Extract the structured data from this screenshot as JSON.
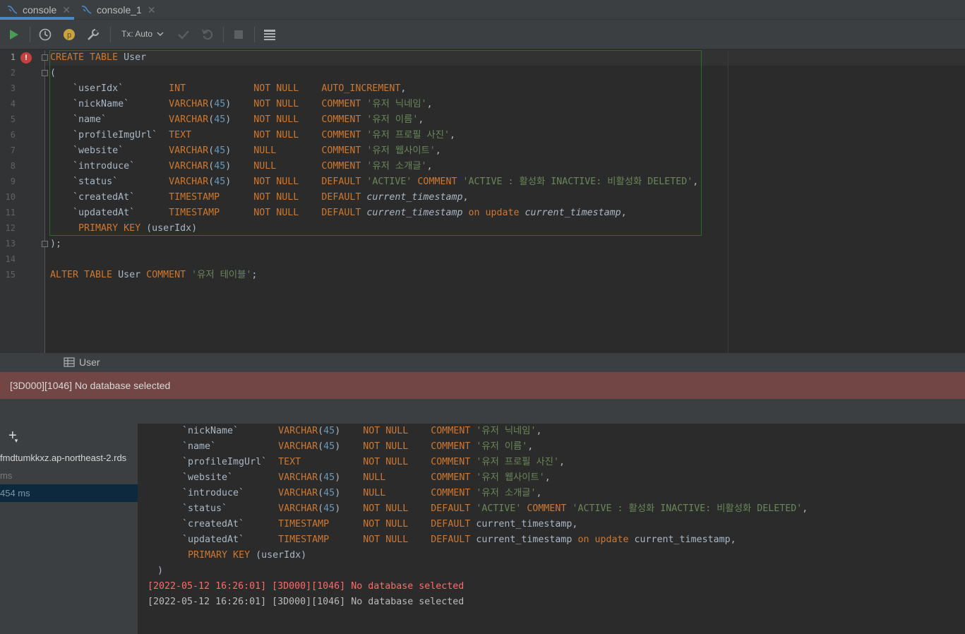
{
  "tabs": [
    {
      "label": "console",
      "icon": "mysql-console-icon",
      "active": true
    },
    {
      "label": "console_1",
      "icon": "mysql-console-icon",
      "active": false
    }
  ],
  "toolbar": {
    "tx_label": "Tx: Auto",
    "buttons": [
      "execute-icon",
      "history-icon",
      "parameters-icon",
      "settings-wrench-icon",
      "commit-icon",
      "rollback-icon",
      "stop-icon",
      "results-table-icon"
    ]
  },
  "editor": {
    "line_numbers": [
      "1",
      "2",
      "3",
      "4",
      "5",
      "6",
      "7",
      "8",
      "9",
      "10",
      "11",
      "12",
      "13",
      "14",
      "15"
    ],
    "lines": [
      [
        [
          "kw",
          "CREATE TABLE "
        ],
        [
          "pl",
          "User"
        ]
      ],
      [
        [
          "pl",
          "("
        ]
      ],
      [
        [
          "pl",
          "    "
        ],
        [
          "bq",
          "`userIdx`"
        ],
        [
          "pl",
          "        "
        ],
        [
          "kw",
          "INT"
        ],
        [
          "pl",
          "            "
        ],
        [
          "kw",
          "NOT NULL"
        ],
        [
          "pl",
          "    "
        ],
        [
          "kw",
          "AUTO_INCREMENT"
        ],
        [
          "pl",
          ","
        ]
      ],
      [
        [
          "pl",
          "    "
        ],
        [
          "bq",
          "`nickName`"
        ],
        [
          "pl",
          "       "
        ],
        [
          "kw",
          "VARCHAR"
        ],
        [
          "pl",
          "("
        ],
        [
          "nm",
          "45"
        ],
        [
          "pl",
          ")    "
        ],
        [
          "kw",
          "NOT NULL"
        ],
        [
          "pl",
          "    "
        ],
        [
          "kw",
          "COMMENT "
        ],
        [
          "st",
          "'유저 닉네임'"
        ],
        [
          "pl",
          ","
        ]
      ],
      [
        [
          "pl",
          "    "
        ],
        [
          "bq",
          "`name`"
        ],
        [
          "pl",
          "           "
        ],
        [
          "kw",
          "VARCHAR"
        ],
        [
          "pl",
          "("
        ],
        [
          "nm",
          "45"
        ],
        [
          "pl",
          ")    "
        ],
        [
          "kw",
          "NOT NULL"
        ],
        [
          "pl",
          "    "
        ],
        [
          "kw",
          "COMMENT "
        ],
        [
          "st",
          "'유저 이름'"
        ],
        [
          "pl",
          ","
        ]
      ],
      [
        [
          "pl",
          "    "
        ],
        [
          "bq",
          "`profileImgUrl`"
        ],
        [
          "pl",
          "  "
        ],
        [
          "kw",
          "TEXT"
        ],
        [
          "pl",
          "           "
        ],
        [
          "kw",
          "NOT NULL"
        ],
        [
          "pl",
          "    "
        ],
        [
          "kw",
          "COMMENT "
        ],
        [
          "st",
          "'유저 프로필 사진'"
        ],
        [
          "pl",
          ","
        ]
      ],
      [
        [
          "pl",
          "    "
        ],
        [
          "bq",
          "`website`"
        ],
        [
          "pl",
          "        "
        ],
        [
          "kw",
          "VARCHAR"
        ],
        [
          "pl",
          "("
        ],
        [
          "nm",
          "45"
        ],
        [
          "pl",
          ")    "
        ],
        [
          "kw",
          "NULL"
        ],
        [
          "pl",
          "        "
        ],
        [
          "kw",
          "COMMENT "
        ],
        [
          "st",
          "'유저 웹사이트'"
        ],
        [
          "pl",
          ","
        ]
      ],
      [
        [
          "pl",
          "    "
        ],
        [
          "bq",
          "`introduce`"
        ],
        [
          "pl",
          "      "
        ],
        [
          "kw",
          "VARCHAR"
        ],
        [
          "pl",
          "("
        ],
        [
          "nm",
          "45"
        ],
        [
          "pl",
          ")    "
        ],
        [
          "kw",
          "NULL"
        ],
        [
          "pl",
          "        "
        ],
        [
          "kw",
          "COMMENT "
        ],
        [
          "st",
          "'유저 소개글'"
        ],
        [
          "pl",
          ","
        ]
      ],
      [
        [
          "pl",
          "    "
        ],
        [
          "bq",
          "`status`"
        ],
        [
          "pl",
          "         "
        ],
        [
          "kw",
          "VARCHAR"
        ],
        [
          "pl",
          "("
        ],
        [
          "nm",
          "45"
        ],
        [
          "pl",
          ")    "
        ],
        [
          "kw",
          "NOT NULL"
        ],
        [
          "pl",
          "    "
        ],
        [
          "kw",
          "DEFAULT "
        ],
        [
          "st",
          "'ACTIVE'"
        ],
        [
          "kw",
          " COMMENT "
        ],
        [
          "st",
          "'ACTIVE : 활성화 INACTIVE: 비활성화 DELETED'"
        ],
        [
          "pl",
          ","
        ]
      ],
      [
        [
          "pl",
          "    "
        ],
        [
          "bq",
          "`createdAt`"
        ],
        [
          "pl",
          "      "
        ],
        [
          "kw",
          "TIMESTAMP"
        ],
        [
          "pl",
          "      "
        ],
        [
          "kw",
          "NOT NULL"
        ],
        [
          "pl",
          "    "
        ],
        [
          "kw",
          "DEFAULT "
        ],
        [
          "it",
          "current_timestamp"
        ],
        [
          "pl",
          ","
        ]
      ],
      [
        [
          "pl",
          "    "
        ],
        [
          "bq",
          "`updatedAt`"
        ],
        [
          "pl",
          "      "
        ],
        [
          "kw",
          "TIMESTAMP"
        ],
        [
          "pl",
          "      "
        ],
        [
          "kw",
          "NOT NULL"
        ],
        [
          "pl",
          "    "
        ],
        [
          "kw",
          "DEFAULT "
        ],
        [
          "it",
          "current_timestamp"
        ],
        [
          "kw",
          " on update "
        ],
        [
          "it",
          "current_timestamp"
        ],
        [
          "pl",
          ","
        ]
      ],
      [
        [
          "pl",
          "     "
        ],
        [
          "kw",
          "PRIMARY KEY "
        ],
        [
          "pl",
          "(userIdx)"
        ]
      ],
      [
        [
          "pl",
          ");"
        ]
      ],
      [
        [
          "pl",
          ""
        ]
      ],
      [
        [
          "kw",
          "ALTER TABLE "
        ],
        [
          "pl",
          "User "
        ],
        [
          "kw",
          "COMMENT "
        ],
        [
          "st",
          "'유저 테이블'"
        ],
        [
          "pl",
          ";"
        ]
      ]
    ]
  },
  "results_tab": {
    "label": "User",
    "icon": "table-icon"
  },
  "error_banner": "[3D000][1046] No database selected",
  "sidebar": {
    "add_icon": "add-plus-icon",
    "rows": [
      {
        "text": "fmdtumkkxz.ap-northeast-2.rds"
      },
      {
        "text": " ms"
      },
      {
        "text": "454 ms",
        "selected": true
      }
    ]
  },
  "output": {
    "lines": [
      [
        [
          "pl",
          "`nickName`"
        ],
        [
          "pl",
          "       "
        ],
        [
          "kw",
          "VARCHAR"
        ],
        [
          "pl",
          "("
        ],
        [
          "nm",
          "45"
        ],
        [
          "pl",
          ")    "
        ],
        [
          "kw",
          "NOT NULL"
        ],
        [
          "pl",
          "    "
        ],
        [
          "kw",
          "COMMENT "
        ],
        [
          "st",
          "'유저 닉네임'"
        ],
        [
          "pl",
          ","
        ]
      ],
      [
        [
          "pl",
          "`name`"
        ],
        [
          "pl",
          "           "
        ],
        [
          "kw",
          "VARCHAR"
        ],
        [
          "pl",
          "("
        ],
        [
          "nm",
          "45"
        ],
        [
          "pl",
          ")    "
        ],
        [
          "kw",
          "NOT NULL"
        ],
        [
          "pl",
          "    "
        ],
        [
          "kw",
          "COMMENT "
        ],
        [
          "st",
          "'유저 이름'"
        ],
        [
          "pl",
          ","
        ]
      ],
      [
        [
          "pl",
          "`profileImgUrl`"
        ],
        [
          "pl",
          "  "
        ],
        [
          "kw",
          "TEXT"
        ],
        [
          "pl",
          "           "
        ],
        [
          "kw",
          "NOT NULL"
        ],
        [
          "pl",
          "    "
        ],
        [
          "kw",
          "COMMENT "
        ],
        [
          "st",
          "'유저 프로필 사진'"
        ],
        [
          "pl",
          ","
        ]
      ],
      [
        [
          "pl",
          "`website`"
        ],
        [
          "pl",
          "        "
        ],
        [
          "kw",
          "VARCHAR"
        ],
        [
          "pl",
          "("
        ],
        [
          "nm",
          "45"
        ],
        [
          "pl",
          ")    "
        ],
        [
          "kw",
          "NULL"
        ],
        [
          "pl",
          "        "
        ],
        [
          "kw",
          "COMMENT "
        ],
        [
          "st",
          "'유저 웹사이트'"
        ],
        [
          "pl",
          ","
        ]
      ],
      [
        [
          "pl",
          "`introduce`"
        ],
        [
          "pl",
          "      "
        ],
        [
          "kw",
          "VARCHAR"
        ],
        [
          "pl",
          "("
        ],
        [
          "nm",
          "45"
        ],
        [
          "pl",
          ")    "
        ],
        [
          "kw",
          "NULL"
        ],
        [
          "pl",
          "        "
        ],
        [
          "kw",
          "COMMENT "
        ],
        [
          "st",
          "'유저 소개글'"
        ],
        [
          "pl",
          ","
        ]
      ],
      [
        [
          "pl",
          "`status`"
        ],
        [
          "pl",
          "         "
        ],
        [
          "kw",
          "VARCHAR"
        ],
        [
          "pl",
          "("
        ],
        [
          "nm",
          "45"
        ],
        [
          "pl",
          ")    "
        ],
        [
          "kw",
          "NOT NULL"
        ],
        [
          "pl",
          "    "
        ],
        [
          "kw",
          "DEFAULT "
        ],
        [
          "st",
          "'ACTIVE'"
        ],
        [
          "kw",
          " COMMENT "
        ],
        [
          "st",
          "'ACTIVE : 활성화 INACTIVE: 비활성화 DELETED'"
        ],
        [
          "pl",
          ","
        ]
      ],
      [
        [
          "pl",
          "`createdAt`"
        ],
        [
          "pl",
          "      "
        ],
        [
          "kw",
          "TIMESTAMP"
        ],
        [
          "pl",
          "      "
        ],
        [
          "kw",
          "NOT NULL"
        ],
        [
          "pl",
          "    "
        ],
        [
          "kw",
          "DEFAULT "
        ],
        [
          "pl",
          "current_timestamp,"
        ]
      ],
      [
        [
          "pl",
          "`updatedAt`"
        ],
        [
          "pl",
          "      "
        ],
        [
          "kw",
          "TIMESTAMP"
        ],
        [
          "pl",
          "      "
        ],
        [
          "kw",
          "NOT NULL"
        ],
        [
          "pl",
          "    "
        ],
        [
          "kw",
          "DEFAULT "
        ],
        [
          "pl",
          "current_timestamp "
        ],
        [
          "kw",
          "on update "
        ],
        [
          "pl",
          "current_timestamp,"
        ]
      ],
      [
        [
          "pl",
          " "
        ],
        [
          "kw",
          "PRIMARY KEY "
        ],
        [
          "pl",
          "(userIdx)"
        ]
      ],
      [
        [
          "pl",
          ")"
        ]
      ]
    ],
    "log_error": "[2022-05-12 16:26:01] [3D000][1046] No database selected",
    "log_plain": "[2022-05-12 16:26:01] [3D000][1046] No database selected"
  },
  "colors": {
    "keyword": "#cc7832",
    "string": "#6a8759",
    "number": "#6897bb",
    "error_bg": "#734646",
    "error_text": "#ff6b68"
  }
}
